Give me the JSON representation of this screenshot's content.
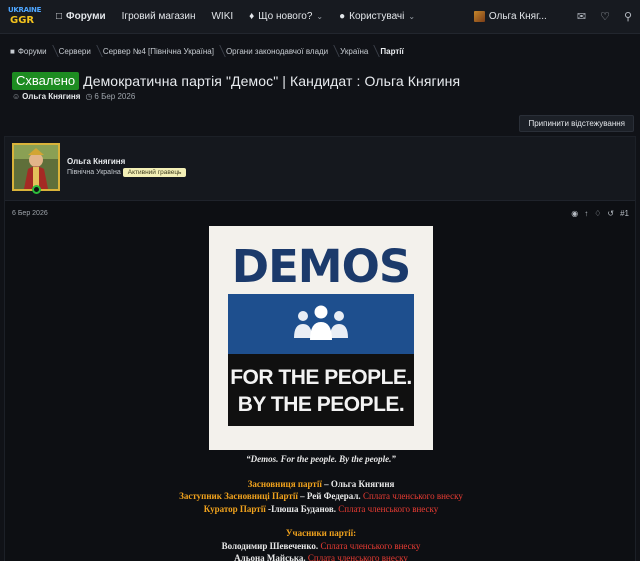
{
  "logo": {
    "line1": "UKRAINE",
    "line2": "GGR"
  },
  "nav": {
    "forums": "Форуми",
    "shop": "Ігровий магазин",
    "wiki": "WIKI",
    "whats_new": "Що нового?",
    "users": "Користувачі",
    "username": "Ольга Княг..."
  },
  "breadcrumb": [
    "Форуми",
    "Сервери",
    "Сервер №4 [Північна Україна]",
    "Органи законодавчої влади",
    "Україна",
    "Партії"
  ],
  "thread": {
    "prefix": "Схвалено",
    "title": "Демократична партія \"Демос\" | Кандидат : Ольга Княгиня",
    "author": "Ольга Княгиня",
    "date": "6 Бер 2026",
    "unwatch_label": "Припинити відстежування"
  },
  "post": {
    "username": "Ольга Княгиня",
    "location": "Північна Україна",
    "user_tag": "Активний гравець",
    "date": "6 Бер 2026",
    "number": "#1",
    "image": {
      "word": "DEMOS",
      "slogan_line1": "FOR THE PEOPLE.",
      "slogan_line2": "BY THE PEOPLE."
    },
    "quote": "“Demos. For the people. By the people.”",
    "founder_label": "Засновниця партії",
    "founder_name": " – Ольга Княгиня",
    "deputy_label": "Заступник Засновниці Партії",
    "deputy_name": " – Рей Федерал.",
    "deputy_note": " Сплата членського внеску",
    "curator_label": "Куратор Партії",
    "curator_name": " -Ілюша Буданов.",
    "curator_note": " Сплата членського внеску",
    "members_label": "Учасники партії:",
    "member1_name": "Володимир Шевеченко.",
    "member1_note": " Сплата членського внеску",
    "member2_name": "Альона Майська.",
    "member2_note": " Сплата членського внеску"
  },
  "colors": {
    "accent_green": "#1d8c21",
    "orange": "#f0a21d",
    "red": "#ea3c33",
    "tag_bg": "#f3efb6",
    "demos_blue": "#1e4f8e"
  }
}
